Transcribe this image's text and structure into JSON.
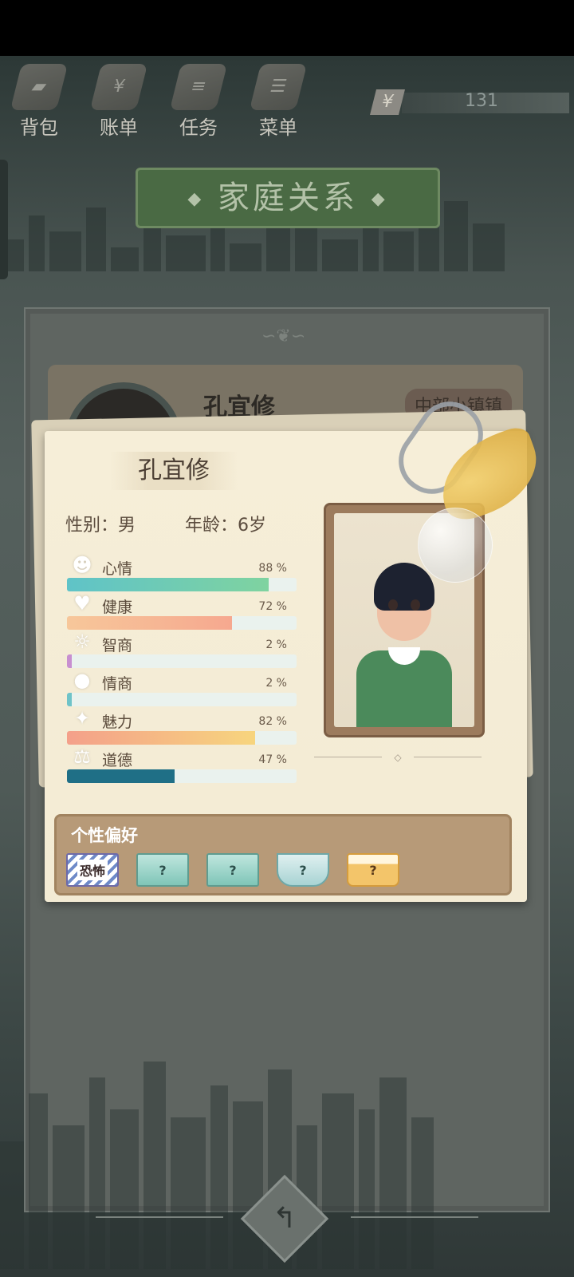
{
  "menu": [
    {
      "label": "背包",
      "icon": "backpack-icon"
    },
    {
      "label": "账单",
      "icon": "bill-icon"
    },
    {
      "label": "任务",
      "icon": "task-icon"
    },
    {
      "label": "菜单",
      "icon": "menu-icon"
    }
  ],
  "money": {
    "symbol": "¥",
    "value": "131"
  },
  "page_title": "家庭关系",
  "back_card": {
    "name": "孔宜修",
    "location": "中部小镇镇"
  },
  "card": {
    "name": "孔宜修",
    "gender": "性别：男",
    "age": "年龄：6岁",
    "stats": [
      {
        "label": "心情",
        "pct": "88 %",
        "value": 88,
        "color_from": "#5fc3c8",
        "color_to": "#7fd3a0",
        "icon": "smile-icon"
      },
      {
        "label": "健康",
        "pct": "72 %",
        "value": 72,
        "color_from": "#f7c79a",
        "color_to": "#f6a88f",
        "icon": "heart-icon"
      },
      {
        "label": "智商",
        "pct": "2 %",
        "value": 2,
        "color_from": "#c88fd0",
        "color_to": "#c88fd0",
        "icon": "lightbulb-icon"
      },
      {
        "label": "情商",
        "pct": "2 %",
        "value": 2,
        "color_from": "#6fc3c8",
        "color_to": "#6fc3c8",
        "icon": "apple-icon"
      },
      {
        "label": "魅力",
        "pct": "82 %",
        "value": 82,
        "color_from": "#f4a08a",
        "color_to": "#f7d57e",
        "icon": "sparkle-icon"
      },
      {
        "label": "道德",
        "pct": "47 %",
        "value": 47,
        "color_from": "#1f6f86",
        "color_to": "#1f6f86",
        "icon": "scale-icon"
      }
    ],
    "prefs_title": "个性偏好",
    "prefs": [
      {
        "type": "tag",
        "label": "恐怖"
      },
      {
        "type": "book",
        "label": "?"
      },
      {
        "type": "book",
        "label": "?"
      },
      {
        "type": "bowl",
        "label": "?"
      },
      {
        "type": "mug",
        "label": "?"
      }
    ]
  },
  "back_button": "↰"
}
